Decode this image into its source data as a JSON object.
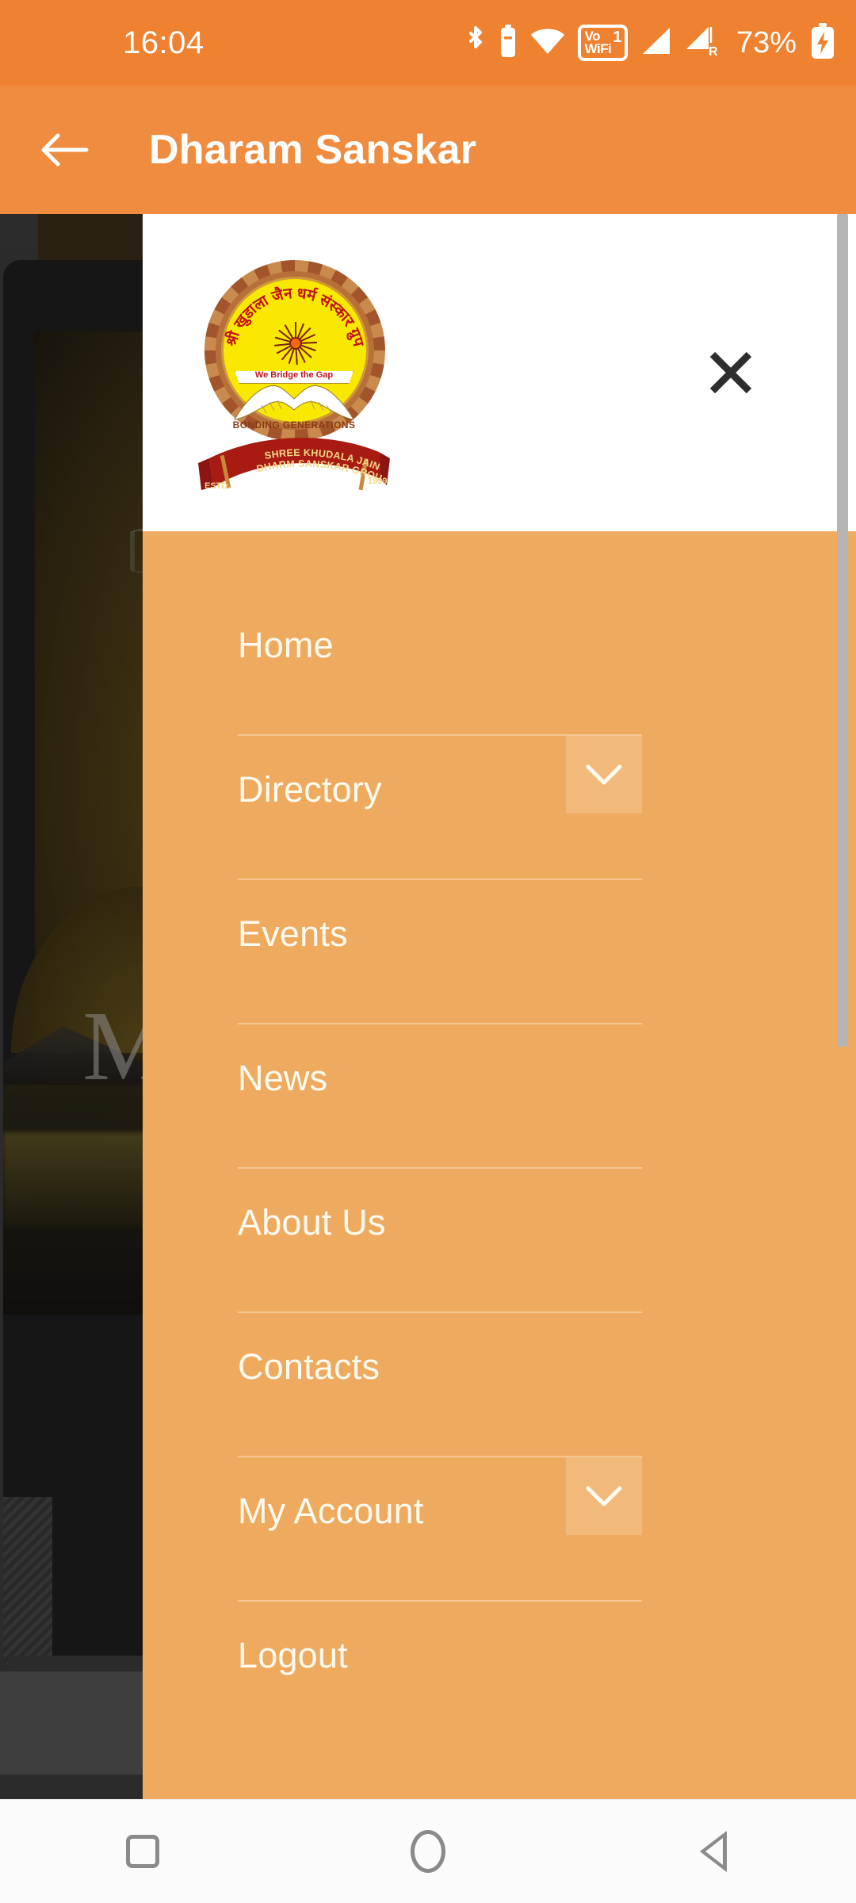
{
  "status_bar": {
    "clock": "16:04",
    "battery_percent": "73%",
    "vowifi_line1": "Vo",
    "vowifi_line2": "WiFi",
    "vowifi_sim": "1",
    "roaming_label": "R",
    "icons": [
      "bluetooth-icon",
      "bluetooth-battery-icon",
      "wifi-icon",
      "vowifi-badge-icon",
      "signal-bars-icon",
      "signal-bars-roaming-icon",
      "battery-charging-icon"
    ]
  },
  "app_bar": {
    "title": "Dharam Sanskar",
    "back_icon": "arrow-left-icon"
  },
  "drawer": {
    "close_icon": "close-icon",
    "logo": {
      "hindi_title": "श्री खुडाला जैन धर्म संस्कार ग्रुप",
      "tagline": "We Bridge the Gap",
      "subtitle": "BONDING GENERATIONS",
      "ribbon_line1": "SHREE KHUDALA JAIN",
      "ribbon_line2": "DHARM SANSKAR GROUP",
      "ribbon_estd": "ESTD.",
      "ribbon_year": "1999"
    },
    "menu": [
      {
        "label": "Home",
        "expandable": false,
        "divider": true
      },
      {
        "label": "Directory",
        "expandable": true,
        "divider": true
      },
      {
        "label": "Events",
        "expandable": false,
        "divider": true
      },
      {
        "label": "News",
        "expandable": false,
        "divider": true
      },
      {
        "label": "About Us",
        "expandable": false,
        "divider": true
      },
      {
        "label": "Contacts",
        "expandable": false,
        "divider": true
      },
      {
        "label": "My Account",
        "expandable": true,
        "divider": true
      },
      {
        "label": "Logout",
        "expandable": false,
        "divider": false
      }
    ],
    "expand_icon": "chevron-down-icon"
  },
  "background": {
    "headline_fragment": "M"
  },
  "nav_bar": {
    "recents_icon": "square-recents-icon",
    "home_icon": "circle-home-icon",
    "back_icon": "triangle-back-icon"
  },
  "colors": {
    "status_bar": "#ef8230",
    "app_bar": "#f08c3f",
    "drawer_menu": "#eeab5f",
    "drawer_header": "#ffffff",
    "menu_text": "#fffaf0",
    "scrollbar": "#b4b4b4",
    "nav_bar": "#fbfbfb"
  }
}
